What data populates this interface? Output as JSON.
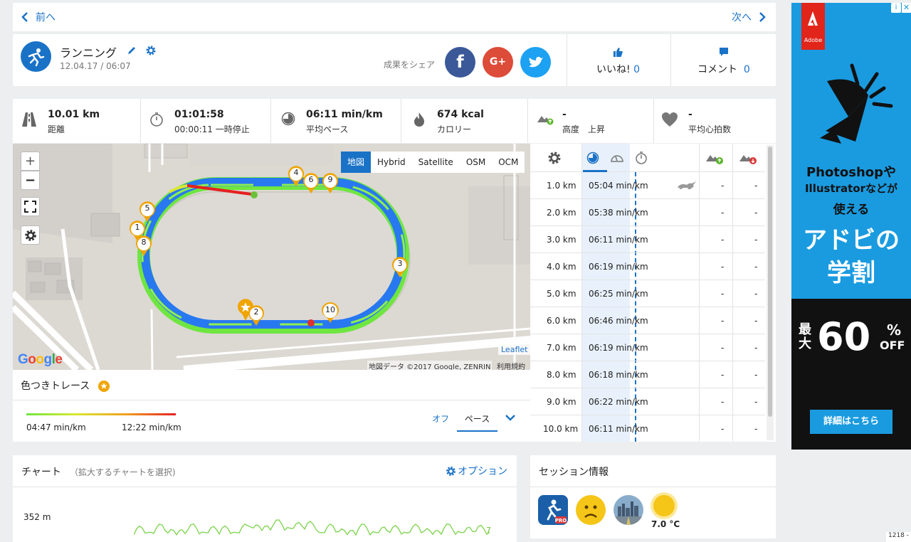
{
  "nav": {
    "prev": "前へ",
    "next": "次へ"
  },
  "activity": {
    "title": "ランニング",
    "datetime": "12.04.17 / 06:07"
  },
  "share": {
    "label": "成果をシェア"
  },
  "likes": {
    "label": "いいね!",
    "count": "0"
  },
  "comments": {
    "label": "コメント",
    "count": "0"
  },
  "stats": [
    {
      "value": "10.01 km",
      "label": "距離",
      "icon": "road-icon"
    },
    {
      "value": "01:01:58",
      "label": "00:00:11 一時停止",
      "icon": "stopwatch-icon"
    },
    {
      "value": "06:11 min/km",
      "label": "平均ペース",
      "icon": "pace-icon"
    },
    {
      "value": "674 kcal",
      "label": "カロリー",
      "icon": "flame-icon"
    },
    {
      "value": "-",
      "label": "高度　上昇",
      "icon": "elevation-icon"
    },
    {
      "value": "-",
      "label": "平均心拍数",
      "icon": "heart-icon"
    }
  ],
  "map": {
    "layers": [
      "地図",
      "Hybrid",
      "Satellite",
      "OSM",
      "OCM"
    ],
    "selected_layer": "地図",
    "google": "Google",
    "leaflet": "Leaflet",
    "attribution": "地図データ ©2017 Google, ZENRIN",
    "terms": "利用規約",
    "markers": [
      "1",
      "2",
      "3",
      "4",
      "5",
      "6",
      "8",
      "9",
      "10"
    ]
  },
  "trace": {
    "title": "色つきトレース",
    "min_label": "04:47 min/km",
    "max_label": "12:22 min/km",
    "toggle_off": "オフ",
    "toggle_pace": "ペース"
  },
  "splits": [
    {
      "km": "1.0 km",
      "pace": "05:04 min/km",
      "a": "-",
      "b": "-"
    },
    {
      "km": "2.0 km",
      "pace": "05:38 min/km",
      "a": "-",
      "b": "-"
    },
    {
      "km": "3.0 km",
      "pace": "06:11 min/km",
      "a": "-",
      "b": "-"
    },
    {
      "km": "4.0 km",
      "pace": "06:19 min/km",
      "a": "-",
      "b": "-"
    },
    {
      "km": "5.0 km",
      "pace": "06:25 min/km",
      "a": "-",
      "b": "-"
    },
    {
      "km": "6.0 km",
      "pace": "06:46 min/km",
      "a": "-",
      "b": "-"
    },
    {
      "km": "7.0 km",
      "pace": "06:19 min/km",
      "a": "-",
      "b": "-"
    },
    {
      "km": "8.0 km",
      "pace": "06:18 min/km",
      "a": "-",
      "b": "-"
    },
    {
      "km": "9.0 km",
      "pace": "06:22 min/km",
      "a": "-",
      "b": "-"
    },
    {
      "km": "10.0 km",
      "pace": "06:11 min/km",
      "a": "-",
      "b": "-"
    }
  ],
  "chart": {
    "title": "チャート",
    "subtitle": "（拡大するチャートを選択)",
    "options": "オプション",
    "y_label": "352 m",
    "right_label": "7"
  },
  "session": {
    "title": "セッション情報",
    "temperature": "7.0 °C"
  },
  "ad": {
    "brand": "Adobe",
    "line1": "Photoshopや",
    "line2": "Illustratorなどが",
    "line3": "使える",
    "line4": "アドビの",
    "line5": "学割",
    "sale_prefix_top": "最",
    "sale_prefix_bottom": "大",
    "sale_number": "60",
    "sale_pct": "%",
    "sale_off": "OFF",
    "cta": "詳細はこちら"
  },
  "corner": {
    "text": "1218 -"
  },
  "colors": {
    "accent": "#1a72c7",
    "facebook": "#3b5998",
    "google": "#dd4b39",
    "twitter": "#1da1f2",
    "track_blue": "#2878f0",
    "track_green": "#6fe640"
  }
}
